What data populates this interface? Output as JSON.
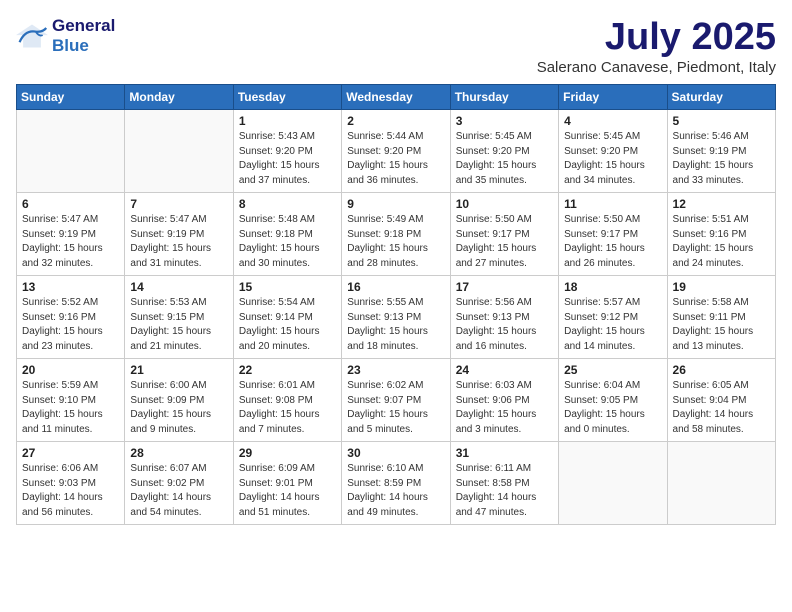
{
  "header": {
    "logo_line1": "General",
    "logo_line2": "Blue",
    "month": "July 2025",
    "location": "Salerano Canavese, Piedmont, Italy"
  },
  "days_of_week": [
    "Sunday",
    "Monday",
    "Tuesday",
    "Wednesday",
    "Thursday",
    "Friday",
    "Saturday"
  ],
  "weeks": [
    [
      {
        "day": "",
        "info": ""
      },
      {
        "day": "",
        "info": ""
      },
      {
        "day": "1",
        "info": "Sunrise: 5:43 AM\nSunset: 9:20 PM\nDaylight: 15 hours\nand 37 minutes."
      },
      {
        "day": "2",
        "info": "Sunrise: 5:44 AM\nSunset: 9:20 PM\nDaylight: 15 hours\nand 36 minutes."
      },
      {
        "day": "3",
        "info": "Sunrise: 5:45 AM\nSunset: 9:20 PM\nDaylight: 15 hours\nand 35 minutes."
      },
      {
        "day": "4",
        "info": "Sunrise: 5:45 AM\nSunset: 9:20 PM\nDaylight: 15 hours\nand 34 minutes."
      },
      {
        "day": "5",
        "info": "Sunrise: 5:46 AM\nSunset: 9:19 PM\nDaylight: 15 hours\nand 33 minutes."
      }
    ],
    [
      {
        "day": "6",
        "info": "Sunrise: 5:47 AM\nSunset: 9:19 PM\nDaylight: 15 hours\nand 32 minutes."
      },
      {
        "day": "7",
        "info": "Sunrise: 5:47 AM\nSunset: 9:19 PM\nDaylight: 15 hours\nand 31 minutes."
      },
      {
        "day": "8",
        "info": "Sunrise: 5:48 AM\nSunset: 9:18 PM\nDaylight: 15 hours\nand 30 minutes."
      },
      {
        "day": "9",
        "info": "Sunrise: 5:49 AM\nSunset: 9:18 PM\nDaylight: 15 hours\nand 28 minutes."
      },
      {
        "day": "10",
        "info": "Sunrise: 5:50 AM\nSunset: 9:17 PM\nDaylight: 15 hours\nand 27 minutes."
      },
      {
        "day": "11",
        "info": "Sunrise: 5:50 AM\nSunset: 9:17 PM\nDaylight: 15 hours\nand 26 minutes."
      },
      {
        "day": "12",
        "info": "Sunrise: 5:51 AM\nSunset: 9:16 PM\nDaylight: 15 hours\nand 24 minutes."
      }
    ],
    [
      {
        "day": "13",
        "info": "Sunrise: 5:52 AM\nSunset: 9:16 PM\nDaylight: 15 hours\nand 23 minutes."
      },
      {
        "day": "14",
        "info": "Sunrise: 5:53 AM\nSunset: 9:15 PM\nDaylight: 15 hours\nand 21 minutes."
      },
      {
        "day": "15",
        "info": "Sunrise: 5:54 AM\nSunset: 9:14 PM\nDaylight: 15 hours\nand 20 minutes."
      },
      {
        "day": "16",
        "info": "Sunrise: 5:55 AM\nSunset: 9:13 PM\nDaylight: 15 hours\nand 18 minutes."
      },
      {
        "day": "17",
        "info": "Sunrise: 5:56 AM\nSunset: 9:13 PM\nDaylight: 15 hours\nand 16 minutes."
      },
      {
        "day": "18",
        "info": "Sunrise: 5:57 AM\nSunset: 9:12 PM\nDaylight: 15 hours\nand 14 minutes."
      },
      {
        "day": "19",
        "info": "Sunrise: 5:58 AM\nSunset: 9:11 PM\nDaylight: 15 hours\nand 13 minutes."
      }
    ],
    [
      {
        "day": "20",
        "info": "Sunrise: 5:59 AM\nSunset: 9:10 PM\nDaylight: 15 hours\nand 11 minutes."
      },
      {
        "day": "21",
        "info": "Sunrise: 6:00 AM\nSunset: 9:09 PM\nDaylight: 15 hours\nand 9 minutes."
      },
      {
        "day": "22",
        "info": "Sunrise: 6:01 AM\nSunset: 9:08 PM\nDaylight: 15 hours\nand 7 minutes."
      },
      {
        "day": "23",
        "info": "Sunrise: 6:02 AM\nSunset: 9:07 PM\nDaylight: 15 hours\nand 5 minutes."
      },
      {
        "day": "24",
        "info": "Sunrise: 6:03 AM\nSunset: 9:06 PM\nDaylight: 15 hours\nand 3 minutes."
      },
      {
        "day": "25",
        "info": "Sunrise: 6:04 AM\nSunset: 9:05 PM\nDaylight: 15 hours\nand 0 minutes."
      },
      {
        "day": "26",
        "info": "Sunrise: 6:05 AM\nSunset: 9:04 PM\nDaylight: 14 hours\nand 58 minutes."
      }
    ],
    [
      {
        "day": "27",
        "info": "Sunrise: 6:06 AM\nSunset: 9:03 PM\nDaylight: 14 hours\nand 56 minutes."
      },
      {
        "day": "28",
        "info": "Sunrise: 6:07 AM\nSunset: 9:02 PM\nDaylight: 14 hours\nand 54 minutes."
      },
      {
        "day": "29",
        "info": "Sunrise: 6:09 AM\nSunset: 9:01 PM\nDaylight: 14 hours\nand 51 minutes."
      },
      {
        "day": "30",
        "info": "Sunrise: 6:10 AM\nSunset: 8:59 PM\nDaylight: 14 hours\nand 49 minutes."
      },
      {
        "day": "31",
        "info": "Sunrise: 6:11 AM\nSunset: 8:58 PM\nDaylight: 14 hours\nand 47 minutes."
      },
      {
        "day": "",
        "info": ""
      },
      {
        "day": "",
        "info": ""
      }
    ]
  ]
}
